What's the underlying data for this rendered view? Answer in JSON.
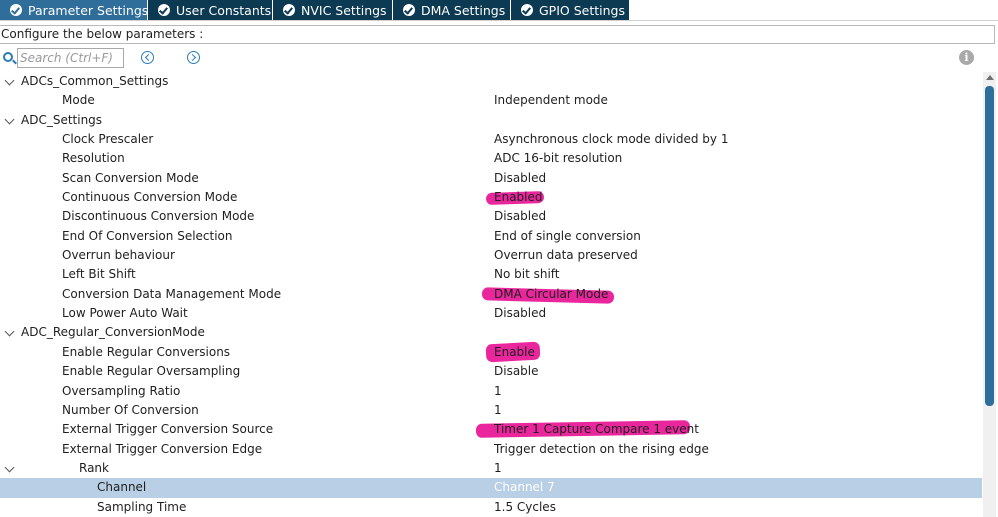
{
  "tabs": [
    {
      "label": "Parameter Settings",
      "active": true
    },
    {
      "label": "User Constants",
      "active": false
    },
    {
      "label": "NVIC Settings",
      "active": false
    },
    {
      "label": "DMA Settings",
      "active": false
    },
    {
      "label": "GPIO Settings",
      "active": false
    }
  ],
  "configure_label": "Configure the below parameters :",
  "search": {
    "placeholder": "Search (Ctrl+F)"
  },
  "info_icon": "i",
  "tree": [
    {
      "label": "ADCs_Common_Settings",
      "value": ""
    },
    {
      "label": "Mode",
      "value": "Independent mode"
    },
    {
      "label": "ADC_Settings",
      "value": ""
    },
    {
      "label": "Clock Prescaler",
      "value": "Asynchronous clock mode divided by 1"
    },
    {
      "label": "Resolution",
      "value": "ADC 16-bit resolution"
    },
    {
      "label": "Scan Conversion Mode",
      "value": "Disabled"
    },
    {
      "label": "Continuous Conversion Mode",
      "value": "Enabled"
    },
    {
      "label": "Discontinuous Conversion Mode",
      "value": "Disabled"
    },
    {
      "label": "End Of Conversion Selection",
      "value": "End of single conversion"
    },
    {
      "label": "Overrun behaviour",
      "value": "Overrun data preserved"
    },
    {
      "label": "Left Bit Shift",
      "value": "No bit shift"
    },
    {
      "label": "Conversion Data Management Mode",
      "value": "DMA Circular Mode"
    },
    {
      "label": "Low Power Auto Wait",
      "value": "Disabled"
    },
    {
      "label": "ADC_Regular_ConversionMode",
      "value": ""
    },
    {
      "label": "Enable Regular Conversions",
      "value": "Enable"
    },
    {
      "label": "Enable Regular Oversampling",
      "value": "Disable"
    },
    {
      "label": "Oversampling Ratio",
      "value": "1"
    },
    {
      "label": "Number Of Conversion",
      "value": "1"
    },
    {
      "label": "External Trigger Conversion Source",
      "value": "Timer 1 Capture Compare 1 event"
    },
    {
      "label": "External Trigger Conversion Edge",
      "value": "Trigger detection on the rising edge"
    },
    {
      "label": "Rank",
      "value": "1"
    },
    {
      "label": "Channel",
      "value": "Channel 7"
    },
    {
      "label": "Sampling Time",
      "value": "1.5 Cycles"
    }
  ],
  "colors": {
    "tab_bg": "#0b3a52",
    "tab_active_bg": "#2f6d9a",
    "selected_row": "#b8cfe5",
    "highlighter": "#e6008c"
  }
}
